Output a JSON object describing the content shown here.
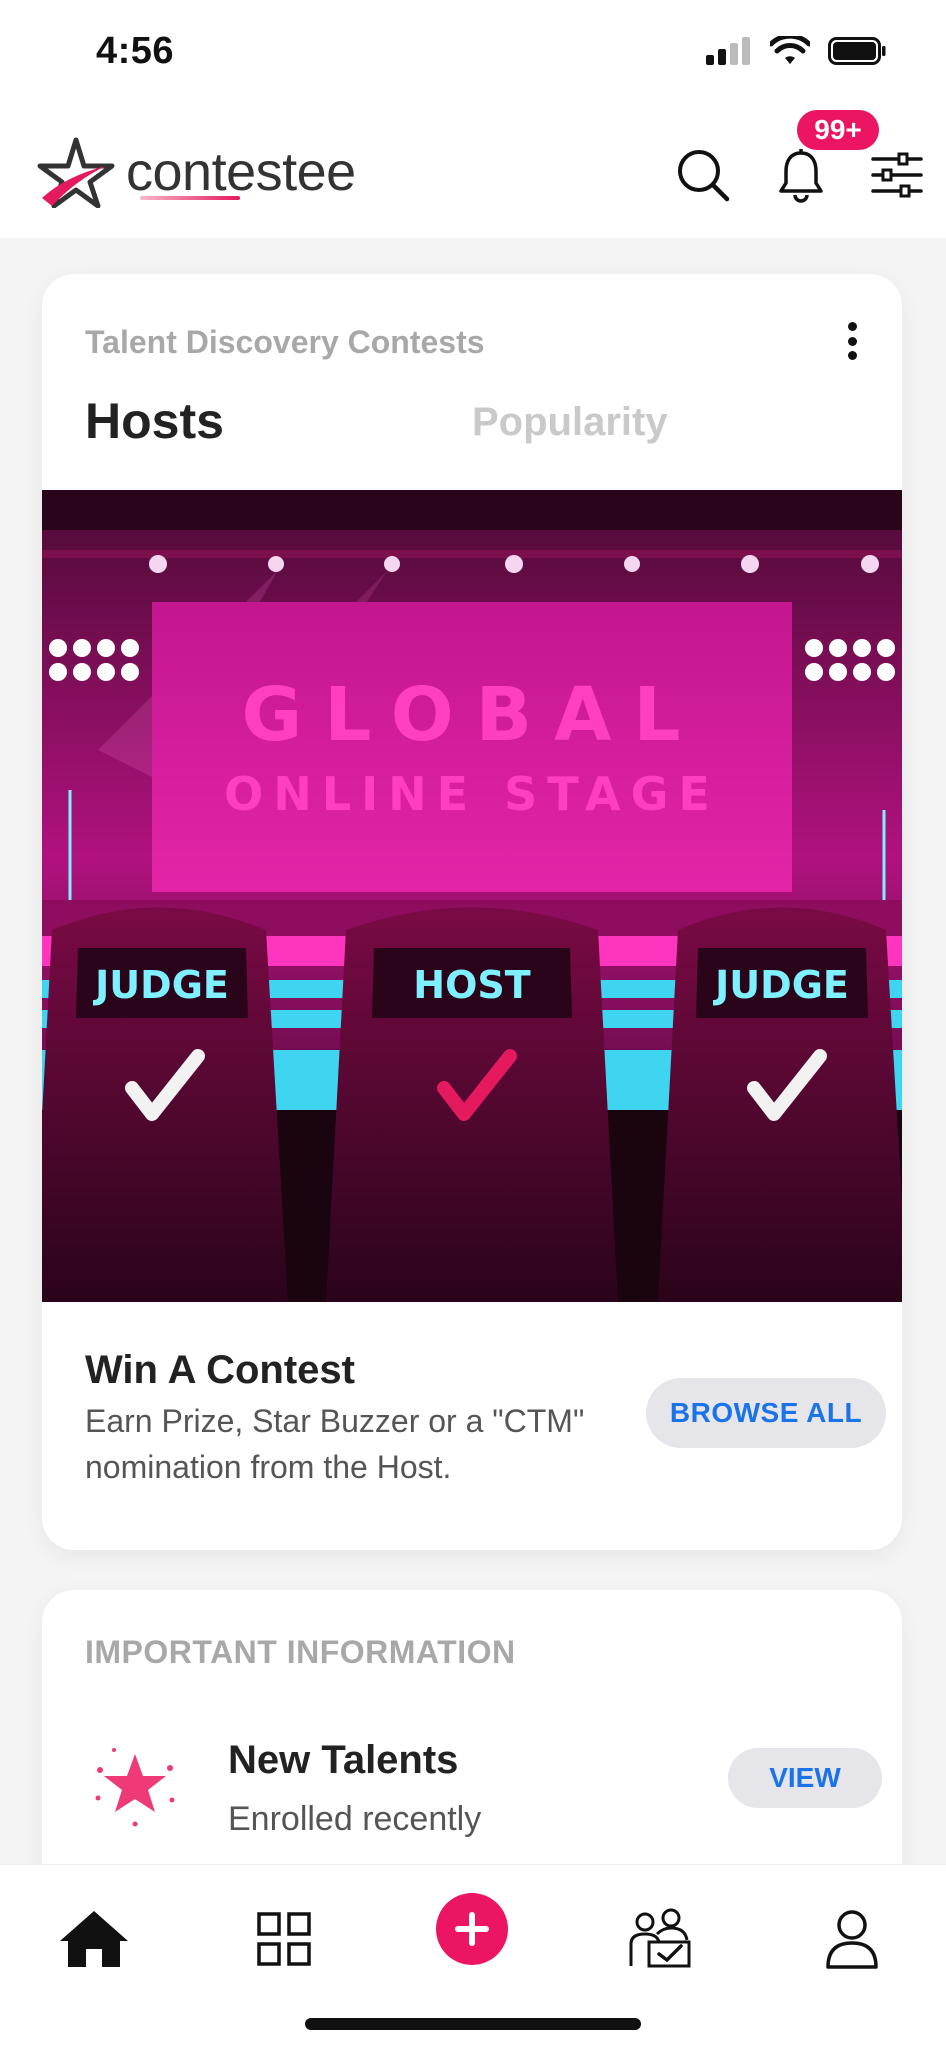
{
  "status_bar": {
    "time": "4:56"
  },
  "header": {
    "logo_text": "contestee",
    "notification_badge": "99+"
  },
  "contests_card": {
    "subtitle": "Talent Discovery Contests",
    "tabs": [
      {
        "label": "Hosts",
        "active": true
      },
      {
        "label": "Popularity",
        "active": false
      }
    ],
    "banner": {
      "title_line1": "GLOBAL",
      "title_line2": "ONLINE STAGE",
      "chairs": [
        "JUDGE",
        "HOST",
        "JUDGE"
      ]
    },
    "win_title": "Win A Contest",
    "win_description": "Earn Prize, Star Buzzer or a \"CTM\" nomination from the Host.",
    "browse_label": "BROWSE ALL"
  },
  "info_card": {
    "title": "IMPORTANT INFORMATION",
    "item": {
      "name": "New Talents",
      "subtitle": "Enrolled recently",
      "button_label": "VIEW"
    }
  },
  "tab_bar": {
    "items": [
      "home-icon",
      "grid-icon",
      "add-icon",
      "judge-icon",
      "profile-icon"
    ]
  },
  "colors": {
    "accent": "#ec1563",
    "link": "#1a73e8",
    "banner_pink": "#ff2fb4"
  }
}
